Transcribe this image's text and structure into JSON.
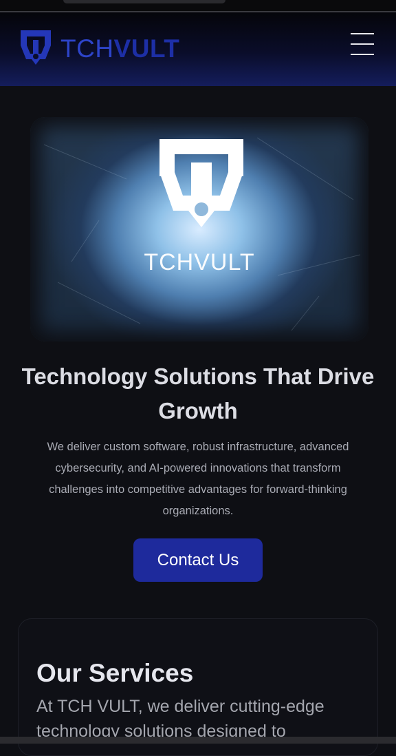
{
  "header": {
    "brand_part1": "TCH",
    "brand_part2": "VULT",
    "logo_icon": "tchvult-logo-icon",
    "menu_icon": "hamburger-menu-icon"
  },
  "hero": {
    "image_wordmark": "TCHVULT",
    "title": "Technology Solutions That Drive Growth",
    "description": "We deliver custom software, robust infrastructure, advanced cybersecurity, and AI-powered innovations that transform challenges into competitive advantages for forward-thinking organizations.",
    "cta_label": "Contact Us"
  },
  "services": {
    "title": "Our Services",
    "description": "At TCH VULT, we deliver cutting-edge technology solutions designed to"
  },
  "colors": {
    "accent": "#1e2a9c",
    "brand_blue": "#2d44c9",
    "background": "#0e0f14"
  }
}
